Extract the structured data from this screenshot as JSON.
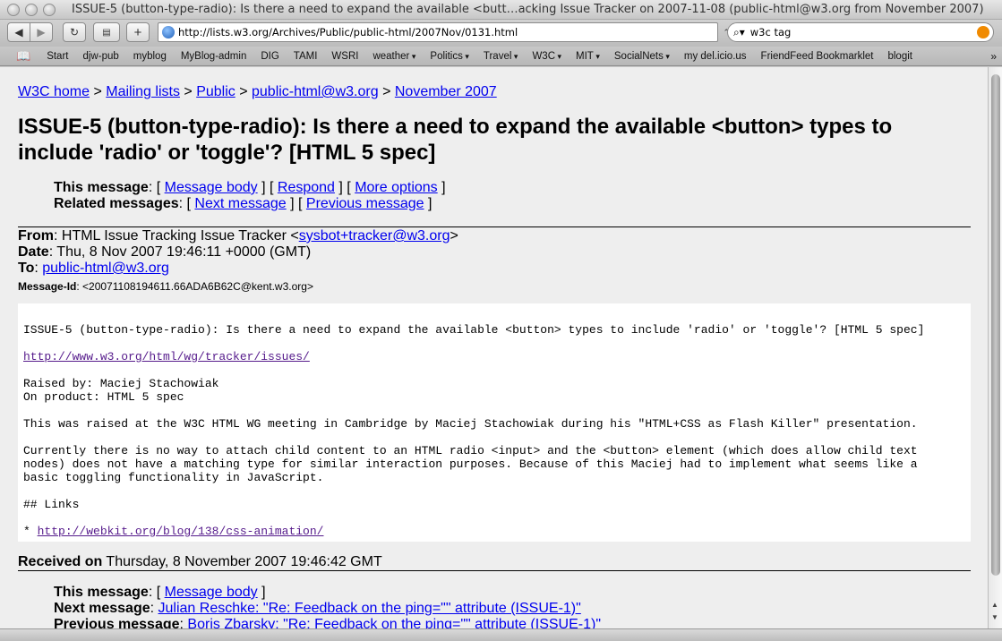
{
  "window": {
    "title": "ISSUE-5 (button-type-radio): Is there a need to expand the available <butt…acking Issue Tracker on 2007-11-08 (public-html@w3.org from November 2007)"
  },
  "toolbar": {
    "url": "http://lists.w3.org/Archives/Public/public-html/2007Nov/0131.html",
    "search": "w3c tag"
  },
  "bookmarks": [
    {
      "label": "Start",
      "menu": false
    },
    {
      "label": "djw-pub",
      "menu": false
    },
    {
      "label": "myblog",
      "menu": false
    },
    {
      "label": "MyBlog-admin",
      "menu": false
    },
    {
      "label": "DIG",
      "menu": false
    },
    {
      "label": "TAMI",
      "menu": false
    },
    {
      "label": "WSRI",
      "menu": false
    },
    {
      "label": "weather",
      "menu": true
    },
    {
      "label": "Politics",
      "menu": true
    },
    {
      "label": "Travel",
      "menu": true
    },
    {
      "label": "W3C",
      "menu": true
    },
    {
      "label": "MIT",
      "menu": true
    },
    {
      "label": "SocialNets",
      "menu": true
    },
    {
      "label": "my del.icio.us",
      "menu": false
    },
    {
      "label": "FriendFeed Bookmarklet",
      "menu": false
    },
    {
      "label": "blogit",
      "menu": false
    }
  ],
  "breadcrumb": [
    "W3C home",
    "Mailing lists",
    "Public",
    "public-html@w3.org",
    "November 2007"
  ],
  "heading": "ISSUE-5 (button-type-radio): Is there a need to expand the available <button> types to include 'radio' or 'toggle'? [HTML 5 spec]",
  "top_meta": {
    "this_label": "This message",
    "this_links": [
      "Message body",
      "Respond",
      "More options"
    ],
    "related_label": "Related messages",
    "related_links": [
      "Next message",
      "Previous message"
    ]
  },
  "headers": {
    "from_label": "From",
    "from_name": "HTML Issue Tracking Issue Tracker <",
    "from_email": "sysbot+tracker@w3.org",
    "date_label": "Date",
    "date_value": "Thu, 8 Nov 2007 19:46:11 +0000 (GMT)",
    "to_label": "To",
    "to_value": "public-html@w3.org",
    "msgid_label": "Message-Id",
    "msgid_value": "<20071108194611.66ADA6B62C@kent.w3.org>"
  },
  "body": {
    "line1": "ISSUE-5 (button-type-radio): Is there a need to expand the available <button> types to include 'radio' or 'toggle'? [HTML 5 spec]",
    "link1": "http://www.w3.org/html/wg/tracker/issues/",
    "line3": "Raised by: Maciej Stachowiak",
    "line4": "On product: HTML 5 spec",
    "line5": "This was raised at the W3C HTML WG meeting in Cambridge by Maciej Stachowiak during his \"HTML+CSS as Flash Killer\" presentation.",
    "line6": "Currently there is no way to attach child content to an HTML radio <input> and the <button> element (which does allow child text",
    "line7": "nodes) does not have a matching type for similar interaction purposes. Because of this Maciej had to implement what seems like a",
    "line8": "basic toggling functionality in JavaScript.",
    "line9": "## Links",
    "bullet": "* ",
    "link2": "http://webkit.org/blog/138/css-animation/"
  },
  "received": {
    "label": "Received on",
    "value": "Thursday, 8 November 2007 19:46:42 GMT"
  },
  "bottom_meta": {
    "this_label": "This message",
    "this_link": "Message body",
    "next_label": "Next message",
    "next_link": "Julian Reschke: \"Re: Feedback on the ping=\"\" attribute (ISSUE-1)\"",
    "prev_label": "Previous message",
    "prev_link": "Boris Zbarsky: \"Re: Feedback on the ping=\"\" attribute (ISSUE-1)\""
  }
}
